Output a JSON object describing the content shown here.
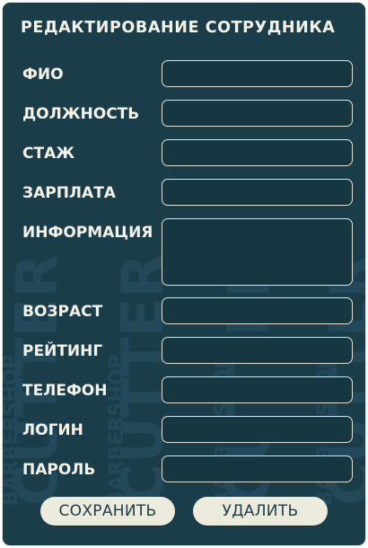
{
  "form": {
    "title": "РЕДАКТИРОВАНИЕ СОТРУДНИКА",
    "fields": [
      {
        "label": "ФИО",
        "value": "",
        "placeholder": ""
      },
      {
        "label": "ДОЛЖНОСТЬ",
        "value": "",
        "placeholder": ""
      },
      {
        "label": "СТАЖ",
        "value": "",
        "placeholder": ""
      },
      {
        "label": "ЗАРПЛАТА",
        "value": "",
        "placeholder": ""
      },
      {
        "label": "ИНФОРМАЦИЯ",
        "value": "",
        "placeholder": ""
      },
      {
        "label": "ВОЗРАСТ",
        "value": "",
        "placeholder": ""
      },
      {
        "label": "РЕЙТИНГ",
        "value": "",
        "placeholder": ""
      },
      {
        "label": "ТЕЛЕФОН",
        "value": "",
        "placeholder": ""
      },
      {
        "label": "ЛОГИН",
        "value": "",
        "placeholder": ""
      },
      {
        "label": "ПАРОЛЬ",
        "value": "",
        "placeholder": ""
      }
    ]
  },
  "actions": {
    "save_label": "СОХРАНИТЬ",
    "delete_label": "УДАЛИТЬ"
  },
  "watermark": {
    "brand": "CUTTER",
    "sub": "BARBERSHOP"
  },
  "colors": {
    "panel_background": "#1b3d4a",
    "text": "#f4f1e6",
    "field_border": "#e4e1d4",
    "button_background": "#ecebdd",
    "button_text": "#1b3d4a"
  }
}
